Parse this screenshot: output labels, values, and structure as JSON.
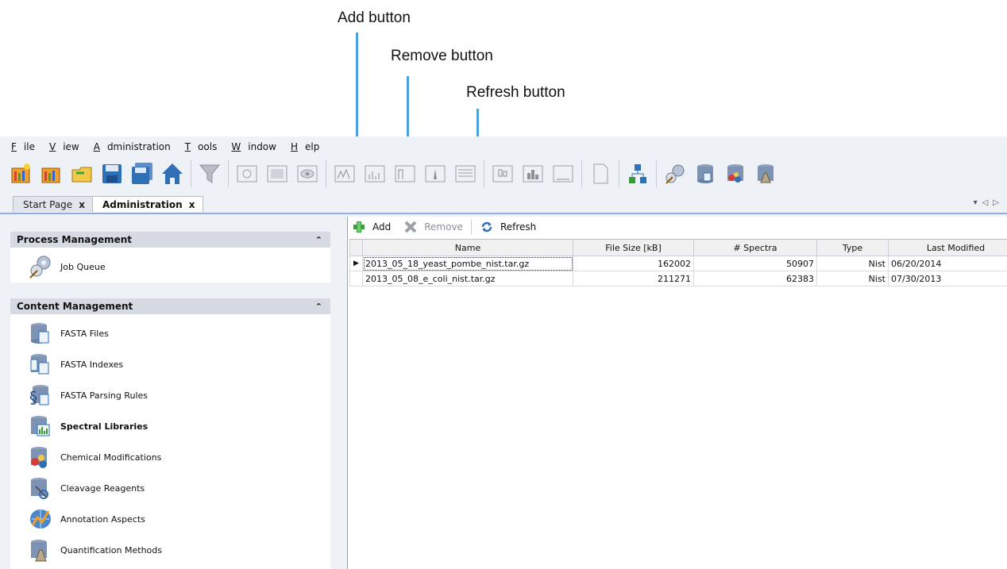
{
  "callouts": {
    "add": "Add button",
    "remove": "Remove button",
    "refresh": "Refresh button"
  },
  "menu": [
    {
      "label": "File",
      "u": "F",
      "rest": "ile"
    },
    {
      "label": "View",
      "u": "V",
      "rest": "iew"
    },
    {
      "label": "Administration",
      "u": "A",
      "rest": "dministration"
    },
    {
      "label": "Tools",
      "u": "T",
      "rest": "ools"
    },
    {
      "label": "Window",
      "u": "W",
      "rest": "indow"
    },
    {
      "label": "Help",
      "u": "H",
      "rest": "elp"
    }
  ],
  "tabs": {
    "start": "Start Page",
    "admin": "Administration",
    "close_glyph": "x"
  },
  "left": {
    "process_header": "Process Management",
    "content_header": "Content Management",
    "collapse_glyph": "≈",
    "job_queue": "Job Queue",
    "fasta_files": "FASTA Files",
    "fasta_indexes": "FASTA Indexes",
    "fasta_parsing_rules": "FASTA Parsing Rules",
    "spectral_libraries": "Spectral Libraries",
    "chemical_modifications": "Chemical Modifications",
    "cleavage_reagents": "Cleavage Reagents",
    "annotation_aspects": "Annotation Aspects",
    "quantification_methods": "Quantification Methods"
  },
  "actions": {
    "add": "Add",
    "remove": "Remove",
    "refresh": "Refresh"
  },
  "table": {
    "columns": [
      "Name",
      "File Size [kB]",
      "# Spectra",
      "Type",
      "Last Modified"
    ],
    "rows": [
      {
        "name": "2013_05_18_yeast_pombe_nist.tar.gz",
        "size": "162002",
        "spectra": "50907",
        "type": "Nist",
        "modified": "06/20/2014"
      },
      {
        "name": "2013_05_08_e_coli_nist.tar.gz",
        "size": "211271",
        "spectra": "62383",
        "type": "Nist",
        "modified": "07/30/2013"
      }
    ]
  },
  "colors": {
    "callout_line": "#4aa3df",
    "section_header_bg": "#d6dae2",
    "accent_blue": "#2f6fb5"
  }
}
